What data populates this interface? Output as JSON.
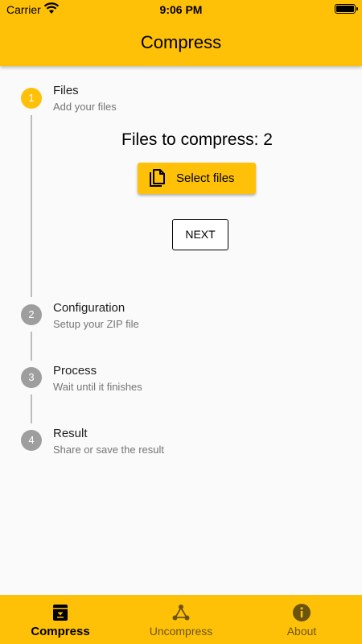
{
  "status_bar": {
    "carrier": "Carrier",
    "time": "9:06 PM"
  },
  "app_bar": {
    "title": "Compress"
  },
  "stepper": {
    "steps": [
      {
        "number": "1",
        "title": "Files",
        "subtitle": "Add your files"
      },
      {
        "number": "2",
        "title": "Configuration",
        "subtitle": "Setup your ZIP file"
      },
      {
        "number": "3",
        "title": "Process",
        "subtitle": "Wait until it finishes"
      },
      {
        "number": "4",
        "title": "Result",
        "subtitle": "Share or save the result"
      }
    ],
    "active_step": 1
  },
  "files_step": {
    "files_count_text": "Files to compress: 2",
    "select_files_label": "Select files",
    "next_label": "NEXT"
  },
  "bottom_nav": {
    "items": [
      {
        "label": "Compress",
        "icon": "archive-icon",
        "active": true
      },
      {
        "label": "Uncompress",
        "icon": "share-tree-icon",
        "active": false
      },
      {
        "label": "About",
        "icon": "info-icon",
        "active": false
      }
    ]
  },
  "colors": {
    "accent": "#FFC107",
    "inactive_step": "#9e9e9e",
    "background": "#fafafa"
  }
}
